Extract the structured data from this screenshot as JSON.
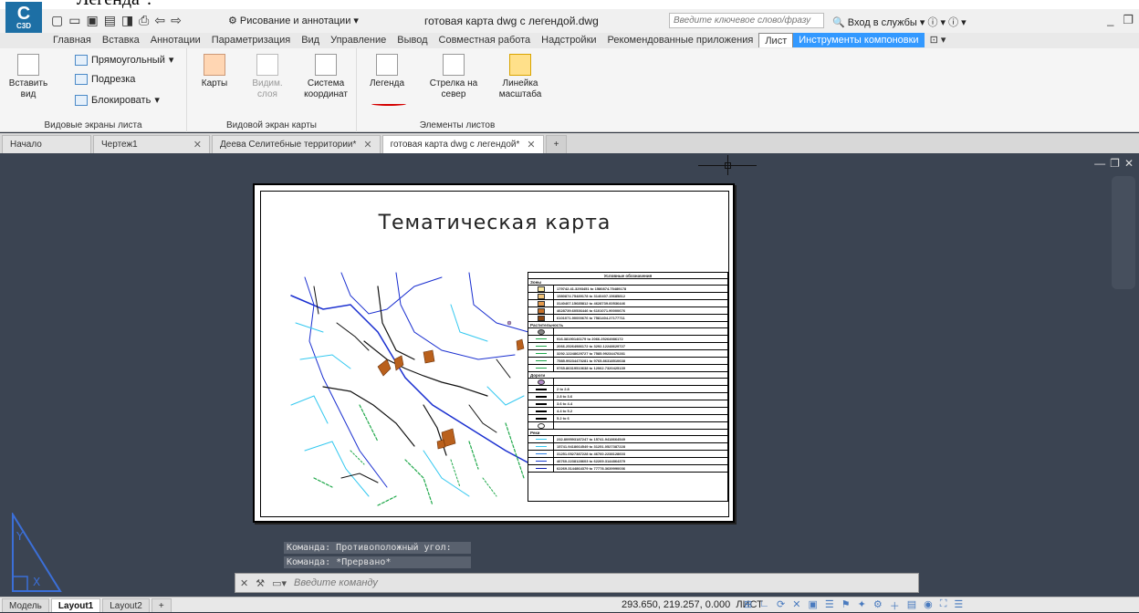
{
  "caption_text": "Легенда\".",
  "app": {
    "logo": "C",
    "logo_sub": "C3D",
    "workspace": "Рисование и аннотации",
    "document_title": "готовая карта dwg с легендой.dwg",
    "search_placeholder": "Введите ключевое слово/фразу",
    "sign_in": "Вход в службы"
  },
  "menu": [
    "Главная",
    "Вставка",
    "Аннотации",
    "Параметризация",
    "Вид",
    "Управление",
    "Вывод",
    "Совместная работа",
    "Надстройки",
    "Рекомендованные приложения",
    "Лист",
    "Инструменты компоновки"
  ],
  "ribbon": {
    "panel1": {
      "title": "Видовые экраны листа",
      "insert_view": "Вставить вид",
      "rect": "Прямоугольный",
      "clip": "Подрезка",
      "lock": "Блокировать"
    },
    "panel2": {
      "title": "Видовой экран карты",
      "maps": "Карты",
      "vis_layers": "Видим. слоя",
      "coord_system": "Система координат"
    },
    "panel3": {
      "title": "Элементы листов",
      "legend": "Легенда",
      "north_arrow": "Стрелка на север",
      "scale_bar": "Линейка масштаба"
    }
  },
  "tabs": [
    {
      "label": "Начало",
      "closable": false
    },
    {
      "label": "Чертеж1",
      "closable": true
    },
    {
      "label": "Деева Селитебные территории*",
      "closable": true
    },
    {
      "label": "готовая карта dwg с легендой*",
      "closable": true,
      "active": true
    }
  ],
  "map": {
    "title": "Тематическая карта",
    "legend_header": "Условные обозначения",
    "sections": [
      {
        "name": "Зоны",
        "rows": [
          {
            "color": "#fbe9a0",
            "text": "179742.41.3293451 to 1580874.75489178"
          },
          {
            "color": "#f3c57a",
            "text": "1580874.75489178 to 3140407.15685812"
          },
          {
            "color": "#e59a4c",
            "text": "3140407.15685812 to 4628739.60536446"
          },
          {
            "color": "#c66f26",
            "text": "4628739.60536446 to 6101071.90000676"
          },
          {
            "color": "#8a4511",
            "text": "6101071.90000676 to 7581404.27177711"
          }
        ]
      },
      {
        "name": "Растительность",
        "rows": [
          {
            "color": "#888",
            "text": ""
          },
          {
            "color": "#1fa84a",
            "text": "916.38190146179 to 2066.25264986172"
          },
          {
            "color": "#1fa84a",
            "text": "2066.25264986172 to 3292.12248629727"
          },
          {
            "color": "#1fa84a",
            "text": "3292.12248629727 to 7585.99234470281"
          },
          {
            "color": "#1fa84a",
            "text": "7585.99234470281 to 9765.86318510638"
          },
          {
            "color": "#1fa84a",
            "text": "9765.86319510638 to 12062.7320425139"
          }
        ]
      },
      {
        "name": "Дороги",
        "rows": [
          {
            "color": "#b38cc9",
            "text": ""
          },
          {
            "color": "#000",
            "text": "2 to 2.8"
          },
          {
            "color": "#000",
            "text": "2.8 to 3.6"
          },
          {
            "color": "#000",
            "text": "3.6 to 4.4"
          },
          {
            "color": "#000",
            "text": "4.4 to 5.2"
          },
          {
            "color": "#000",
            "text": "5.2 to 6"
          },
          {
            "color": "#fff",
            "text": ""
          }
        ]
      },
      {
        "name": "Реки",
        "rows": [
          {
            "color": "#33c8f0",
            "text": "232.809593187247 to 15741.9418664549"
          },
          {
            "color": "#33c8f0",
            "text": "15741.9418664549 to 31251.0527387228"
          },
          {
            "color": "#2d7fe0",
            "text": "31251.0527387228 to 46760.2238128603"
          },
          {
            "color": "#1b3fd0",
            "text": "46760.2238128603 to 62269.3144864379"
          },
          {
            "color": "#1020b0",
            "text": "62269.3144864379 to 77778.3639990036"
          }
        ]
      }
    ]
  },
  "command": {
    "history": [
      "Команда: Противоположный угол:",
      "Команда: *Прервано*"
    ],
    "placeholder": "Введите команду"
  },
  "status": {
    "tabs": [
      "Модель",
      "Layout1",
      "Layout2"
    ],
    "active_tab": "Layout1",
    "coords": "293.650, 219.257, 0.000",
    "mode": "ЛИСТ"
  }
}
